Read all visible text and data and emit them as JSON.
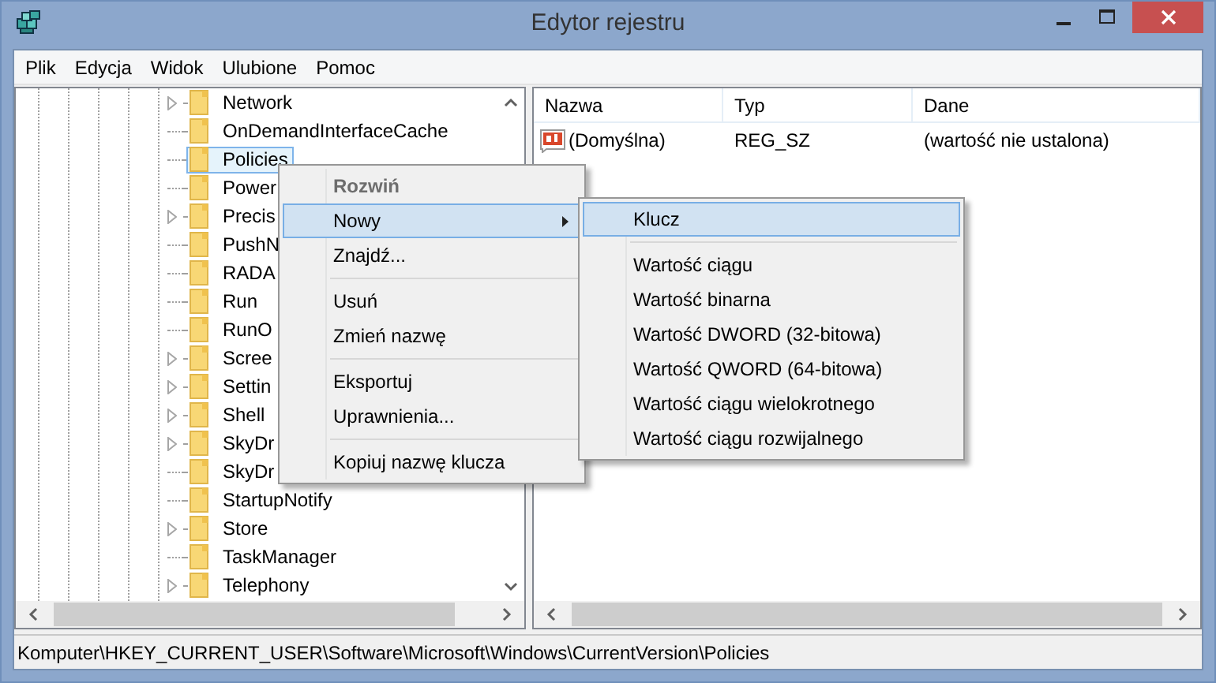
{
  "window": {
    "title": "Edytor rejestru"
  },
  "menu_bar": [
    "Plik",
    "Edycja",
    "Widok",
    "Ulubione",
    "Pomoc"
  ],
  "tree": {
    "items": [
      {
        "label": "Network",
        "expandable": true,
        "selected": false
      },
      {
        "label": "OnDemandInterfaceCache",
        "expandable": false,
        "selected": false
      },
      {
        "label": "Policies",
        "expandable": false,
        "selected": true
      },
      {
        "label": "Power",
        "expandable": false,
        "selected": false
      },
      {
        "label": "Precis",
        "expandable": true,
        "selected": false
      },
      {
        "label": "PushN",
        "expandable": false,
        "selected": false
      },
      {
        "label": "RADA",
        "expandable": false,
        "selected": false
      },
      {
        "label": "Run",
        "expandable": false,
        "selected": false
      },
      {
        "label": "RunO",
        "expandable": false,
        "selected": false
      },
      {
        "label": "Scree",
        "expandable": true,
        "selected": false
      },
      {
        "label": "Settin",
        "expandable": true,
        "selected": false
      },
      {
        "label": "Shell",
        "expandable": true,
        "selected": false
      },
      {
        "label": "SkyDr",
        "expandable": true,
        "selected": false
      },
      {
        "label": "SkyDr",
        "expandable": false,
        "selected": false
      },
      {
        "label": "StartupNotify",
        "expandable": false,
        "selected": false
      },
      {
        "label": "Store",
        "expandable": true,
        "selected": false
      },
      {
        "label": "TaskManager",
        "expandable": false,
        "selected": false
      },
      {
        "label": "Telephony",
        "expandable": true,
        "selected": false
      }
    ]
  },
  "values": {
    "columns": [
      "Nazwa",
      "Typ",
      "Dane"
    ],
    "rows": [
      {
        "name": "(Domyślna)",
        "type": "REG_SZ",
        "data": "(wartość nie ustalona)"
      }
    ]
  },
  "context_menu": {
    "items": [
      {
        "kind": "item",
        "label": "Rozwiń",
        "default": true,
        "disabled": true,
        "submenu": false,
        "selected": false
      },
      {
        "kind": "item",
        "label": "Nowy",
        "default": false,
        "disabled": false,
        "submenu": true,
        "selected": true
      },
      {
        "kind": "item",
        "label": "Znajdź...",
        "default": false,
        "disabled": false,
        "submenu": false,
        "selected": false
      },
      {
        "kind": "separator"
      },
      {
        "kind": "item",
        "label": "Usuń",
        "default": false,
        "disabled": false,
        "submenu": false,
        "selected": false
      },
      {
        "kind": "item",
        "label": "Zmień nazwę",
        "default": false,
        "disabled": false,
        "submenu": false,
        "selected": false
      },
      {
        "kind": "separator"
      },
      {
        "kind": "item",
        "label": "Eksportuj",
        "default": false,
        "disabled": false,
        "submenu": false,
        "selected": false
      },
      {
        "kind": "item",
        "label": "Uprawnienia...",
        "default": false,
        "disabled": false,
        "submenu": false,
        "selected": false
      },
      {
        "kind": "separator"
      },
      {
        "kind": "item",
        "label": "Kopiuj nazwę klucza",
        "default": false,
        "disabled": false,
        "submenu": false,
        "selected": false
      }
    ]
  },
  "submenu": {
    "items": [
      {
        "kind": "item",
        "label": "Klucz",
        "selected": true
      },
      {
        "kind": "separator"
      },
      {
        "kind": "item",
        "label": "Wartość ciągu",
        "selected": false
      },
      {
        "kind": "item",
        "label": "Wartość binarna",
        "selected": false
      },
      {
        "kind": "item",
        "label": "Wartość DWORD (32-bitowa)",
        "selected": false
      },
      {
        "kind": "item",
        "label": "Wartość QWORD (64-bitowa)",
        "selected": false
      },
      {
        "kind": "item",
        "label": "Wartość ciągu wielokrotnego",
        "selected": false
      },
      {
        "kind": "item",
        "label": "Wartość ciągu rozwijalnego",
        "selected": false
      }
    ]
  },
  "status_bar": "Komputer\\HKEY_CURRENT_USER\\Software\\Microsoft\\Windows\\CurrentVersion\\Policies"
}
